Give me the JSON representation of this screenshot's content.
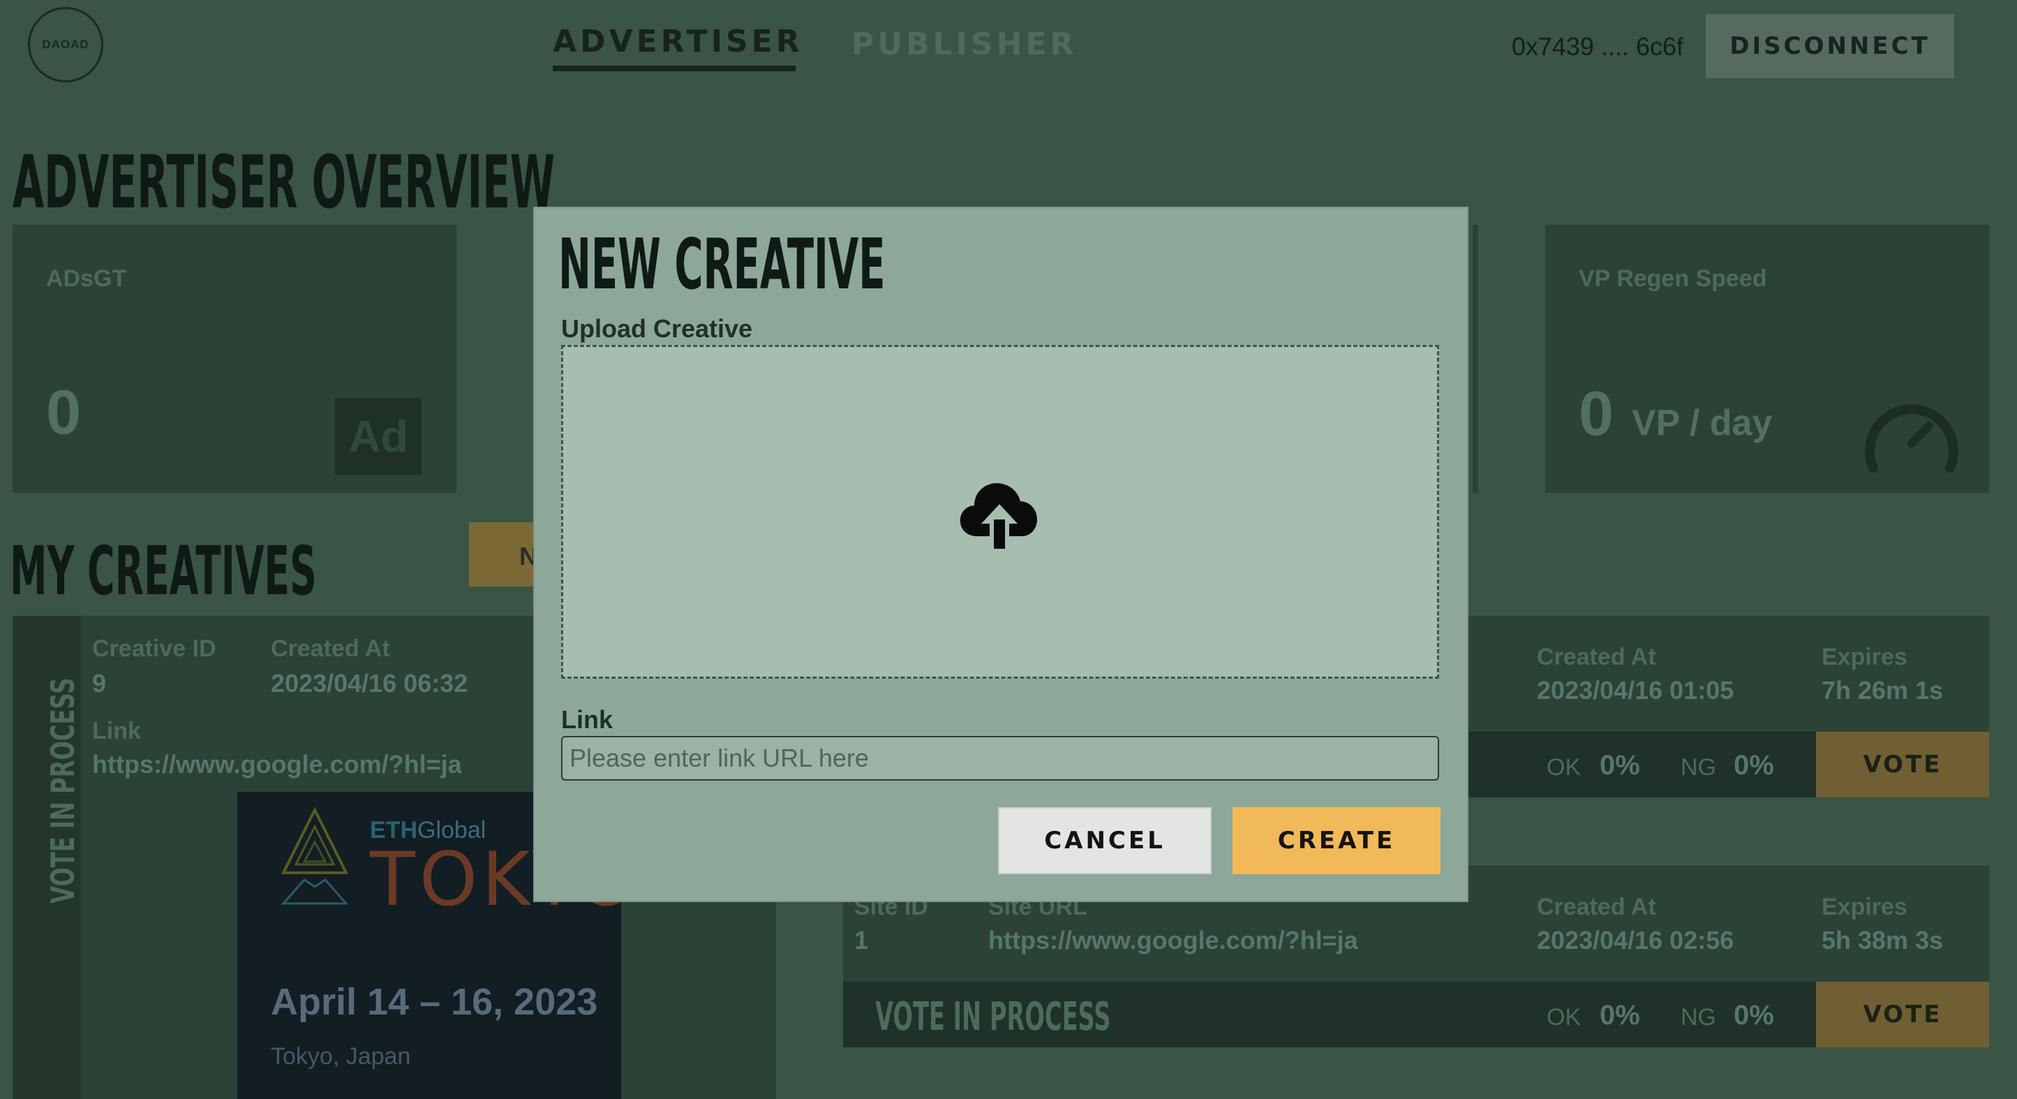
{
  "app": {
    "logo_text": "DAOAD",
    "nav_tabs": [
      {
        "label": "ADVERTISER",
        "active": true
      },
      {
        "label": "PUBLISHER",
        "active": false
      }
    ],
    "wallet_address": "0x7439 .... 6c6f",
    "disconnect_label": "DISCONNECT"
  },
  "overview": {
    "title": "ADVERTISER OVERVIEW",
    "cards": [
      {
        "label": "ADsGT",
        "value": "0",
        "badge": "Ad"
      },
      {
        "label": "VP Regen Speed",
        "value": "0",
        "unit": "VP / day"
      }
    ]
  },
  "creatives": {
    "title": "MY CREATIVES",
    "new_button_partial": "N",
    "item": {
      "status_label": "VOTE IN PROCESS",
      "creative_id_label": "Creative ID",
      "creative_id": "9",
      "created_at_label": "Created At",
      "created_at": "2023/04/16 06:32",
      "link_label": "Link",
      "link": "https://www.google.com/?hl=ja",
      "banner": {
        "brand_a": "ETH",
        "brand_b": "Global",
        "city": "TOKYO",
        "dates": "April 14 – 16, 2023",
        "place": "Tokyo, Japan"
      }
    }
  },
  "sites": [
    {
      "created_at_label": "Created At",
      "created_at": "2023/04/16 01:05",
      "expires_label": "Expires",
      "expires": "7h 26m 1s",
      "ok_label": "OK",
      "ok_value": "0%",
      "ng_label": "NG",
      "ng_value": "0%",
      "vote_label": "VOTE"
    },
    {
      "site_id_label": "Site ID",
      "site_id": "1",
      "site_url_label": "Site URL",
      "site_url": "https://www.google.com/?hl=ja",
      "created_at_label": "Created At",
      "created_at": "2023/04/16 02:56",
      "expires_label": "Expires",
      "expires": "5h 38m 3s",
      "status_label": "VOTE IN PROCESS",
      "ok_label": "OK",
      "ok_value": "0%",
      "ng_label": "NG",
      "ng_value": "0%",
      "vote_label": "VOTE"
    }
  ],
  "modal": {
    "title": "NEW CREATIVE",
    "upload_label": "Upload Creative",
    "upload_icon": "cloud-upload-icon",
    "link_label": "Link",
    "link_placeholder": "Please enter link URL here",
    "link_value": "",
    "cancel_label": "CANCEL",
    "create_label": "CREATE"
  },
  "colors": {
    "background": "#3a5446",
    "card": "#2c4236",
    "modal": "#8da899",
    "accent": "#f2b959"
  }
}
